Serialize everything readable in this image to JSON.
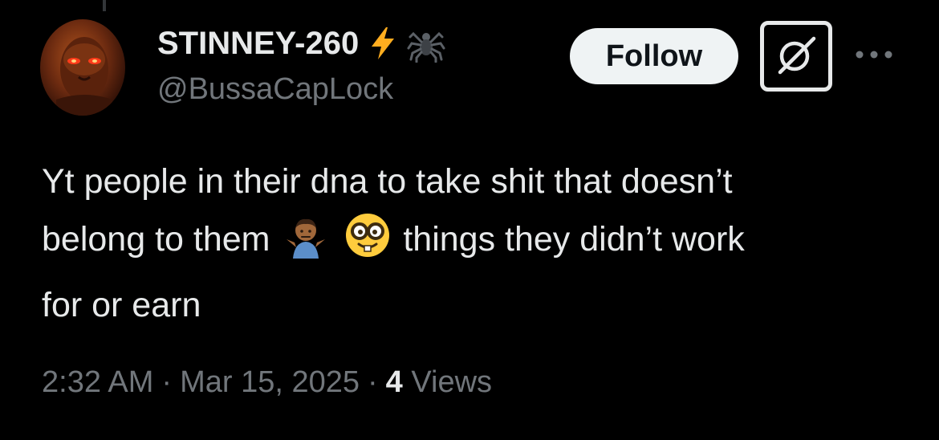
{
  "user": {
    "display_name": "STINNEY-260",
    "handle": "@BussaCapLock",
    "name_icons": [
      "lightning-bolt-icon",
      "spider-icon"
    ],
    "avatar": "avatar"
  },
  "actions": {
    "follow_label": "Follow",
    "grok_icon": "grok-icon",
    "more_icon": "more-dots-icon"
  },
  "tweet": {
    "line1": "Yt people in their dna to take shit that doesn’t",
    "line2_start": "belong to them",
    "emoji_1": "person-shrugging-emoji",
    "emoji_2": "nerd-face-emoji",
    "line2_end": "things they didn’t work",
    "line3": "for or earn"
  },
  "meta": {
    "time": "2:32 AM",
    "separator": "·",
    "date": "Mar 15, 2025",
    "views_count": "4",
    "views_label": "Views"
  },
  "colors": {
    "background": "#000000",
    "text_primary": "#e7e9ea",
    "text_secondary": "#71767b",
    "follow_bg": "#eff3f4",
    "lightning": "#ffad1f"
  }
}
